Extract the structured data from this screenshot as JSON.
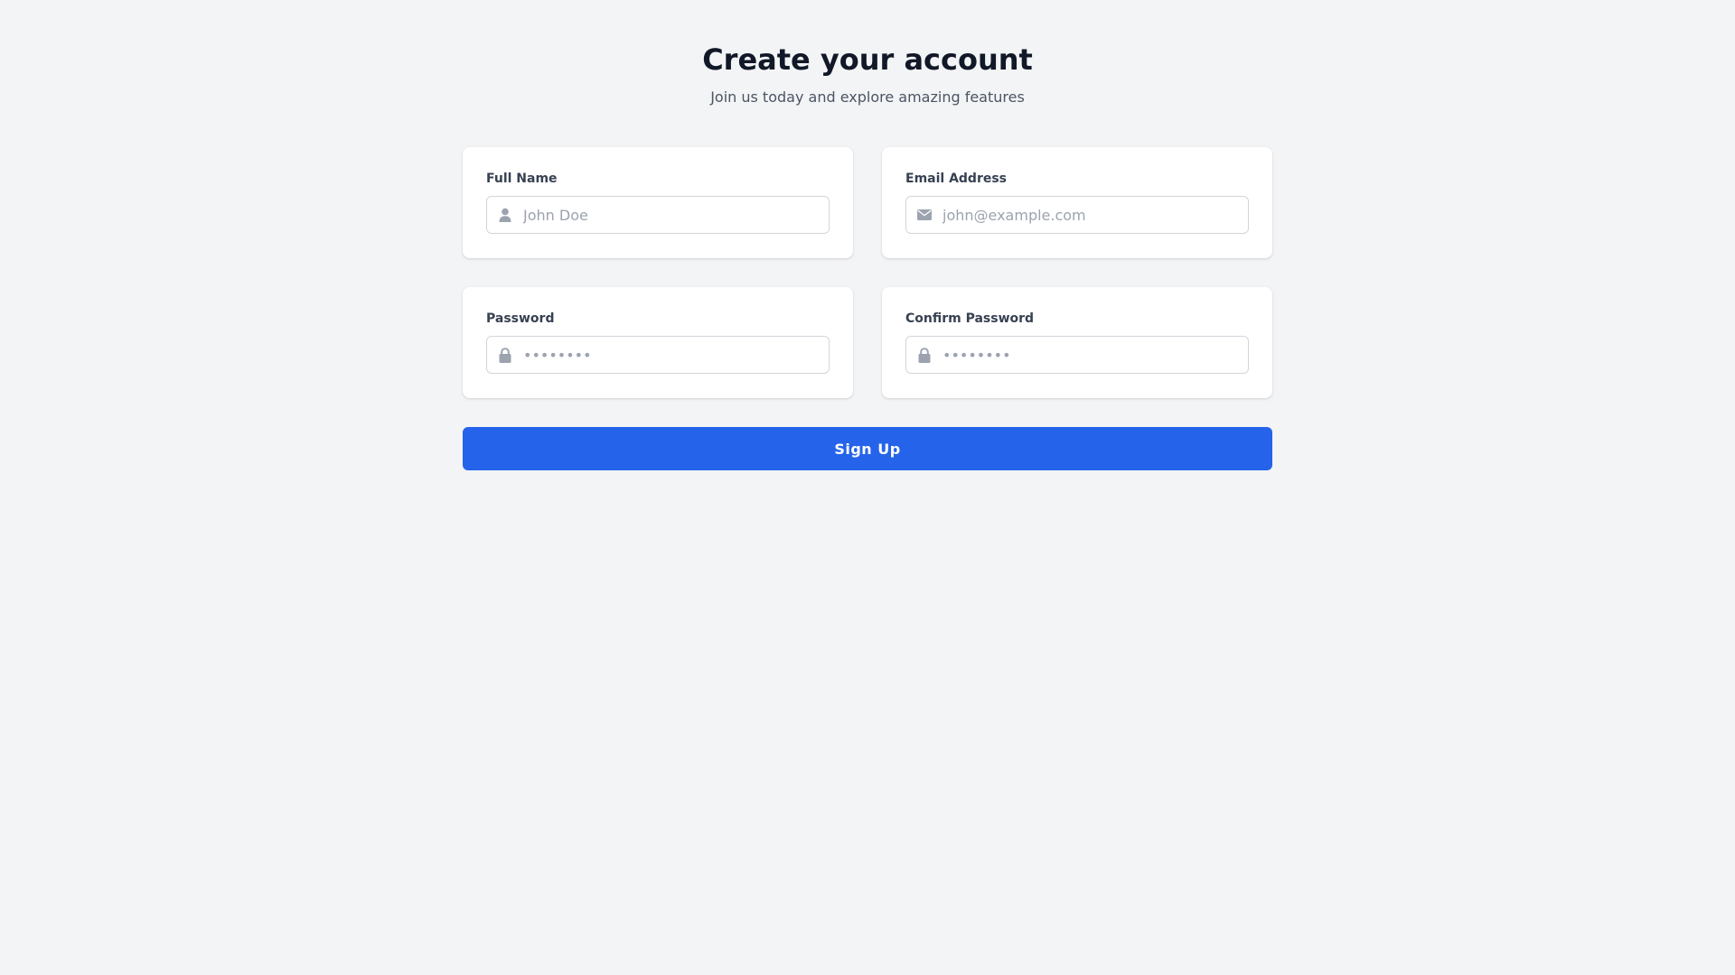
{
  "header": {
    "title": "Create your account",
    "subtitle": "Join us today and explore amazing features"
  },
  "fields": {
    "full_name": {
      "label": "Full Name",
      "placeholder": "John Doe",
      "value": "",
      "icon": "user-icon"
    },
    "email": {
      "label": "Email Address",
      "placeholder": "john@example.com",
      "value": "",
      "icon": "envelope-icon"
    },
    "password": {
      "label": "Password",
      "placeholder": "••••••••",
      "value": "",
      "icon": "lock-icon"
    },
    "confirm_password": {
      "label": "Confirm Password",
      "placeholder": "••••••••",
      "value": "",
      "icon": "lock-icon"
    }
  },
  "submit": {
    "label": "Sign Up"
  },
  "colors": {
    "background": "#f3f4f6",
    "primary": "#2563eb",
    "icon": "#9ca3af",
    "border": "#d1d5db"
  }
}
